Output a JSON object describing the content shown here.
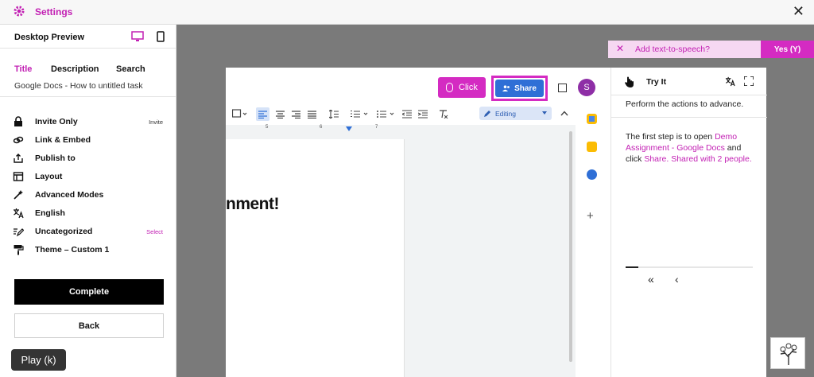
{
  "topbar": {
    "title": "Settings"
  },
  "left_panel": {
    "preview_label": "Desktop Preview",
    "tabs": [
      {
        "label": "Title"
      },
      {
        "label": "Description"
      },
      {
        "label": "Search"
      }
    ],
    "title_value": "Google Docs - How to untitled task",
    "menu": [
      {
        "label": "Invite Only",
        "aux": "Invite",
        "icon": "lock-icon"
      },
      {
        "label": "Link & Embed",
        "aux": "",
        "icon": "link-icon"
      },
      {
        "label": "Publish to",
        "aux": "",
        "icon": "share-up-icon"
      },
      {
        "label": "Layout",
        "aux": "",
        "icon": "layout-icon"
      },
      {
        "label": "Advanced Modes",
        "aux": "",
        "icon": "wand-icon"
      },
      {
        "label": "English",
        "aux": "",
        "icon": "translate-icon"
      },
      {
        "label": "Uncategorized",
        "aux": "Select",
        "icon": "folder-edit-icon"
      },
      {
        "label": "Theme – Custom 1",
        "aux": "",
        "icon": "paint-roller-icon"
      }
    ],
    "complete_label": "Complete",
    "back_label": "Back"
  },
  "player": {
    "play_label": "Play (k)"
  },
  "preview": {
    "click_label": "Click",
    "share_label": "Share",
    "avatar_letter": "S",
    "editing_label": "Editing",
    "ruler_marks": [
      "5",
      "6",
      "7"
    ],
    "doc_text": "nment!"
  },
  "tts": {
    "question": "Add text-to-speech?",
    "yes_label": "Yes (Y)"
  },
  "guide": {
    "title": "Try It",
    "instruction": "Perform the actions to advance.",
    "step_prefix": "The first step is to open ",
    "step_link1": "Demo Assignment - Google Docs",
    "step_mid": " and click ",
    "step_link2": "Share. Shared with 2 people.",
    "progress": 0.1
  },
  "colors": {
    "accent": "#c21fb3",
    "share_blue": "#2f6fd6"
  }
}
